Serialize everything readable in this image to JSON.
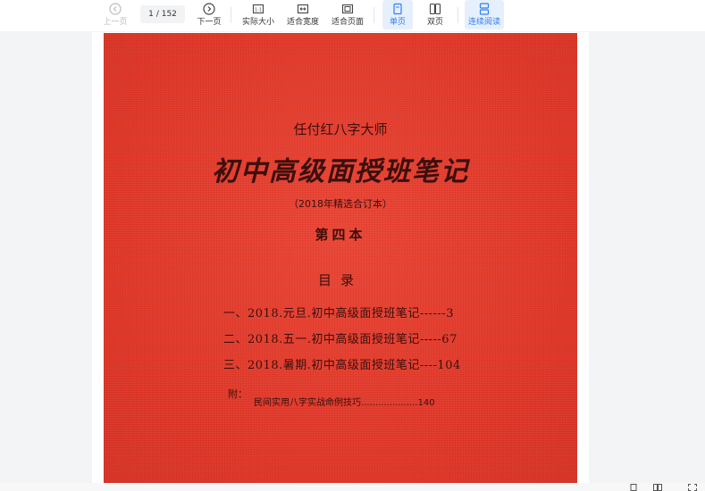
{
  "toolbar": {
    "prev_label": "上一页",
    "page_current": "1",
    "page_total": "/ 152",
    "next_label": "下一页",
    "actual_size_label": "实际大小",
    "fit_width_label": "适合宽度",
    "fit_page_label": "适合页面",
    "single_page_label": "单页",
    "double_page_label": "双页",
    "continuous_label": "连续阅读"
  },
  "cover": {
    "author": "任付红八字大师",
    "title": "初中高级面授班笔记",
    "subtitle": "（2018年精选合订本）",
    "volume": "第四本",
    "toc_heading": "目录",
    "toc": [
      "一、2018.元旦.初中高级面授班笔记------3",
      "二、2018.五一.初中高级面授班笔记-----67",
      "三、2018.暑期.初中高级面授班笔记----104"
    ],
    "appendix_label": "附：",
    "appendix_item": "民间实用八字实战命例技巧....................140"
  },
  "colors": {
    "cover_red": "#e43a2c",
    "cover_text": "#3b0f0c",
    "accent_blue": "#2f7df6",
    "active_bg": "#e6f0fd"
  },
  "icons": {
    "prev": "chevron-left-circle-icon",
    "next": "chevron-right-circle-icon",
    "actual_size": "actual-size-icon",
    "fit_width": "fit-width-icon",
    "fit_page": "fit-page-icon",
    "single_page": "single-page-icon",
    "double_page": "double-page-icon",
    "continuous": "continuous-scroll-icon"
  }
}
